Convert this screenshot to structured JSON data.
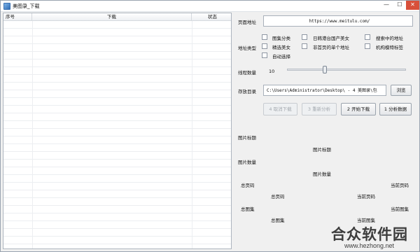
{
  "window": {
    "title": "美图录_下载",
    "min_glyph": "—",
    "max_glyph": "☐",
    "close_glyph": "✕"
  },
  "list": {
    "columns": [
      "序号",
      "下载",
      "状态"
    ]
  },
  "form": {
    "page_url_label": "页面地址",
    "page_url_value": "https://www.meitulu.com/",
    "address_type_label": "地址类型",
    "options": [
      {
        "label": "图集分类",
        "checked": false
      },
      {
        "label": "日韩港台国产美女",
        "checked": false
      },
      {
        "label": "搜索中的地址",
        "checked": false
      },
      {
        "label": "精选美女",
        "checked": false
      },
      {
        "label": "非首页的单个地址",
        "checked": false
      },
      {
        "label": "机构模特标签",
        "checked": false
      },
      {
        "label": "自动选择",
        "checked": false
      }
    ],
    "thread_label": "线程数量",
    "thread_value": "10",
    "thread_slider_fraction": 0.3,
    "save_dir_label": "存放目录",
    "save_dir_value": "C:\\Users\\Administrator\\Desktop\\ - 4 美图录\\包",
    "browse_label": "浏览"
  },
  "actions": {
    "cancel": "4 取消下载",
    "reparse": "3 重新分析",
    "start": "2 开始下载",
    "analyze": "1 分析数据"
  },
  "info": {
    "pic_title_label": "图片标题",
    "pic_title_value": "图片标题",
    "pic_count_label": "图片数量",
    "pic_count_value": "图片数量",
    "total_pages_label": "总页码",
    "total_pages_value": "总页码",
    "current_page_label": "当前页码",
    "current_page_value": "当前页码",
    "total_albums_label": "总图集",
    "total_albums_value": "总图集",
    "current_album_label": "当前图集",
    "current_album_value": "当前图集"
  },
  "watermark": {
    "brand": "合众软件园",
    "url": "www.hezhong.net"
  }
}
